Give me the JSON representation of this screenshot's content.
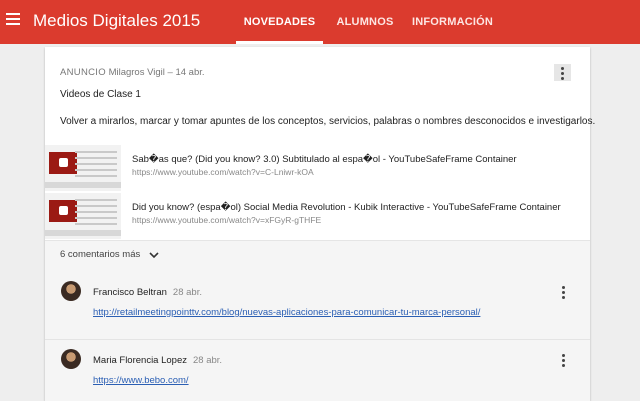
{
  "app": {
    "title": "Medios Digitales 2015",
    "brand_color": "#db3b2e",
    "menu_icon": "hamburger-menu-icon"
  },
  "tabs": [
    {
      "label": "NOVEDADES",
      "active": true
    },
    {
      "label": "ALUMNOS",
      "active": false
    },
    {
      "label": "INFORMACIÓN",
      "active": false
    }
  ],
  "post": {
    "type": "ANUNCIO",
    "author": "Milagros Vigil",
    "separator": "–",
    "date": "14 abr.",
    "title": "Videos de Clase 1",
    "body": "Volver a mirarlos, marcar y tomar apuntes de los conceptos, servicios, palabras o nombres desconocidos e investigarlos.",
    "attachments": [
      {
        "title": "Sab�as que? (Did you know? 3.0) Subtitulado al espa�ol - YouTubeSafeFrame Container",
        "url": "https://www.youtube.com/watch?v=C-Lniwr-kOA"
      },
      {
        "title": "Did you know? (espa�ol) Social Media Revolution - Kubik Interactive - YouTubeSafeFrame Container",
        "url": "https://www.youtube.com/watch?v=xFGyR-gTHFE"
      }
    ]
  },
  "comments_section": {
    "more_label": "6 comentarios más",
    "comments": [
      {
        "author": "Francisco Beltran",
        "date": "28 abr.",
        "link": "http://retailmeetingpointtv.com/blog/nuevas-aplicaciones-para-comunicar-tu-marca-personal/"
      },
      {
        "author": "Maria Florencia Lopez",
        "date": "28 abr.",
        "link": "https://www.bebo.com/"
      }
    ]
  }
}
